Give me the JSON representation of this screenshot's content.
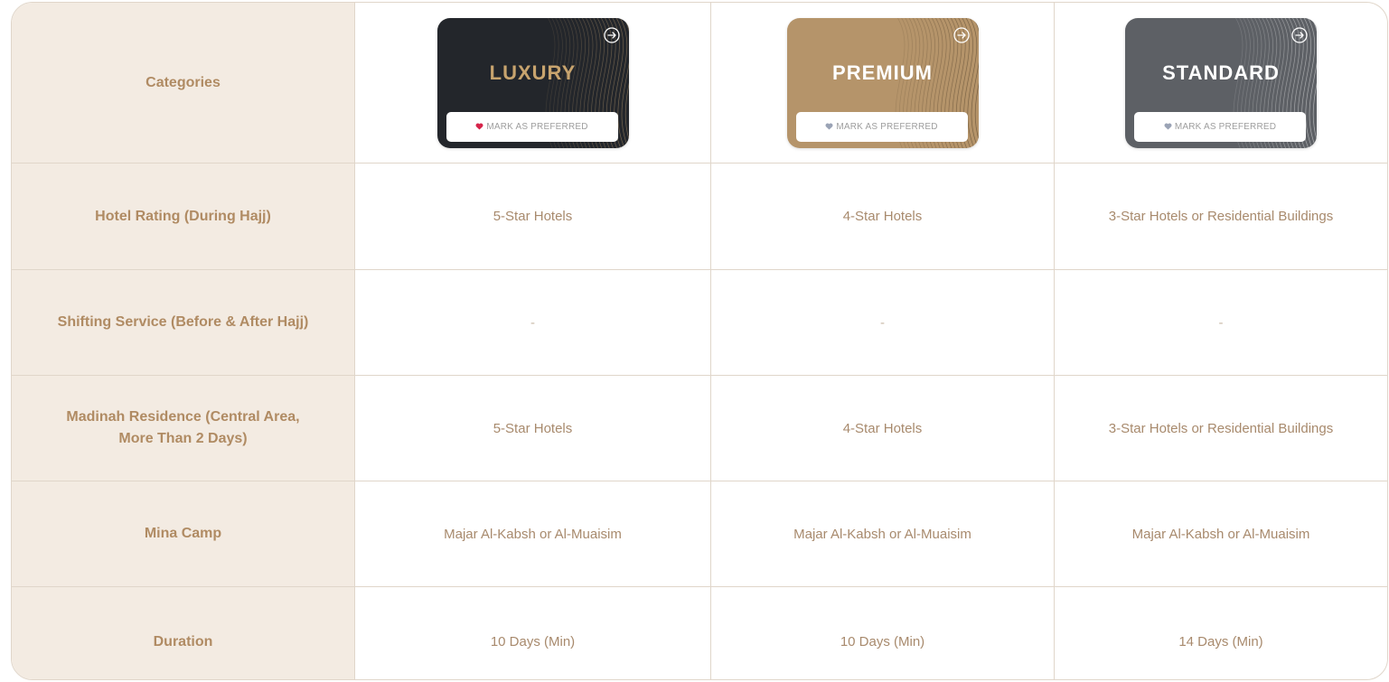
{
  "header": {
    "label": "Categories",
    "cards": [
      {
        "title": "LUXURY",
        "button_label": "MARK AS PREFERRED",
        "bg": "#23262b",
        "title_color": "#c8a46e",
        "heart_color": "#d6244a",
        "line_color": "#caa878"
      },
      {
        "title": "PREMIUM",
        "button_label": "MARK AS PREFERRED",
        "bg": "#b5946a",
        "title_color": "#ffffff",
        "heart_color": "#9aa3b5",
        "line_color": "#3a2d1d"
      },
      {
        "title": "STANDARD",
        "button_label": "MARK AS PREFERRED",
        "bg": "#5d6065",
        "title_color": "#ffffff",
        "heart_color": "#9aa3b5",
        "line_color": "#ffffff"
      }
    ]
  },
  "rows": [
    {
      "label": "Hotel Rating (During Hajj)",
      "values": [
        "5-Star Hotels",
        "4-Star Hotels",
        "3-Star Hotels or Residential Buildings"
      ]
    },
    {
      "label": "Shifting Service (Before & After Hajj)",
      "values": [
        "-",
        "-",
        "-"
      ]
    },
    {
      "label": "Madinah Residence (Central Area, More Than 2 Days)",
      "values": [
        "5-Star Hotels",
        "4-Star Hotels",
        "3-Star Hotels or Residential Buildings"
      ]
    },
    {
      "label": "Mina Camp",
      "values": [
        "Majar Al-Kabsh or Al-Muaisim",
        "Majar Al-Kabsh or Al-Muaisim",
        "Majar Al-Kabsh or Al-Muaisim"
      ]
    },
    {
      "label": "Duration",
      "values": [
        "10 Days (Min)",
        "10 Days (Min)",
        "14 Days (Min)"
      ]
    }
  ],
  "colors": {
    "label_bg": "#f3ebe2",
    "label_text": "#b08b63",
    "value_text": "#a88a6d",
    "border": "#e0d6ca"
  }
}
